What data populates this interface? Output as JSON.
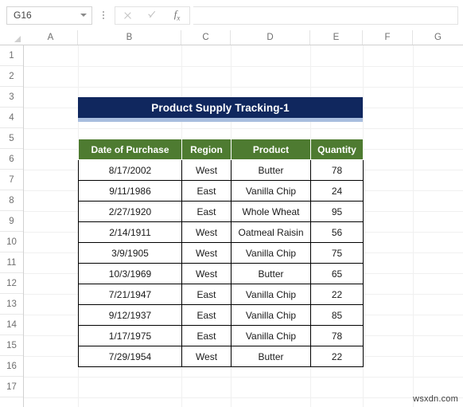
{
  "formula_bar": {
    "name_box_value": "G16",
    "cancel_icon": "close-icon",
    "enter_icon": "check-icon",
    "function_icon": "fx-icon",
    "function_label": "fx",
    "formula_value": "",
    "formula_placeholder": ""
  },
  "grid": {
    "column_headers": [
      "A",
      "B",
      "C",
      "D",
      "E",
      "F",
      "G"
    ],
    "row_headers": [
      "1",
      "2",
      "3",
      "4",
      "5",
      "6",
      "7",
      "8",
      "9",
      "10",
      "11",
      "12",
      "13",
      "14",
      "15",
      "16",
      "17"
    ]
  },
  "title_banner": {
    "text": "Product Supply Tracking-1",
    "background_color": "#10275E",
    "text_color": "#FFFFFF",
    "underline_color": "#A8BDDE"
  },
  "table": {
    "header_background": "#4E7B31",
    "header_text_color": "#FFFFFF",
    "border_color": "#000000",
    "columns": [
      "Date of Purchase",
      "Region",
      "Product",
      "Quantity"
    ],
    "rows": [
      {
        "date": "8/17/2002",
        "region": "West",
        "product": "Butter",
        "quantity": "78"
      },
      {
        "date": "9/11/1986",
        "region": "East",
        "product": "Vanilla Chip",
        "quantity": "24"
      },
      {
        "date": "2/27/1920",
        "region": "East",
        "product": "Whole Wheat",
        "quantity": "95"
      },
      {
        "date": "2/14/1911",
        "region": "West",
        "product": "Oatmeal Raisin",
        "quantity": "56"
      },
      {
        "date": "3/9/1905",
        "region": "West",
        "product": "Vanilla Chip",
        "quantity": "75"
      },
      {
        "date": "10/3/1969",
        "region": "West",
        "product": "Butter",
        "quantity": "65"
      },
      {
        "date": "7/21/1947",
        "region": "East",
        "product": "Vanilla Chip",
        "quantity": "22"
      },
      {
        "date": "9/12/1937",
        "region": "East",
        "product": "Vanilla Chip",
        "quantity": "85"
      },
      {
        "date": "1/17/1975",
        "region": "East",
        "product": "Vanilla Chip",
        "quantity": "78"
      },
      {
        "date": "7/29/1954",
        "region": "West",
        "product": "Butter",
        "quantity": "22"
      }
    ]
  },
  "watermark": {
    "text": "wsxdn.com"
  }
}
